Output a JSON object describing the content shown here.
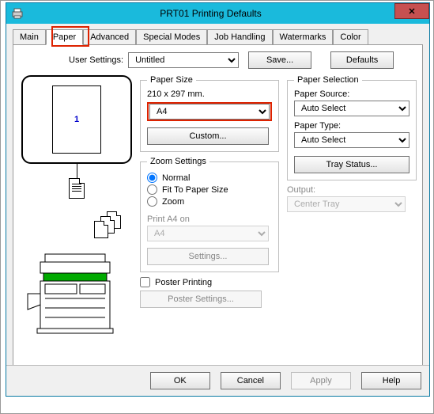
{
  "titlebar": {
    "title": "PRT01 Printing Defaults"
  },
  "tabs": {
    "main": "Main",
    "paper": "Paper",
    "advanced": "Advanced",
    "special_modes": "Special Modes",
    "job_handling": "Job Handling",
    "watermarks": "Watermarks",
    "color": "Color"
  },
  "user_settings": {
    "label": "User Settings:",
    "value": "Untitled",
    "save": "Save...",
    "defaults": "Defaults"
  },
  "preview": {
    "page_number": "1"
  },
  "paper_size": {
    "legend": "Paper Size",
    "dims": "210 x 297 mm.",
    "value": "A4",
    "custom": "Custom..."
  },
  "zoom": {
    "legend": "Zoom Settings",
    "normal": "Normal",
    "fit": "Fit To Paper Size",
    "zoom": "Zoom",
    "print_on_label": "Print A4 on",
    "print_on_value": "A4",
    "settings": "Settings..."
  },
  "poster": {
    "label": "Poster Printing",
    "settings": "Poster Settings..."
  },
  "selection": {
    "legend": "Paper Selection",
    "source_label": "Paper Source:",
    "source_value": "Auto Select",
    "type_label": "Paper Type:",
    "type_value": "Auto Select",
    "tray_status": "Tray Status..."
  },
  "output": {
    "label": "Output:",
    "value": "Center Tray"
  },
  "buttons": {
    "ok": "OK",
    "cancel": "Cancel",
    "apply": "Apply",
    "help": "Help"
  }
}
